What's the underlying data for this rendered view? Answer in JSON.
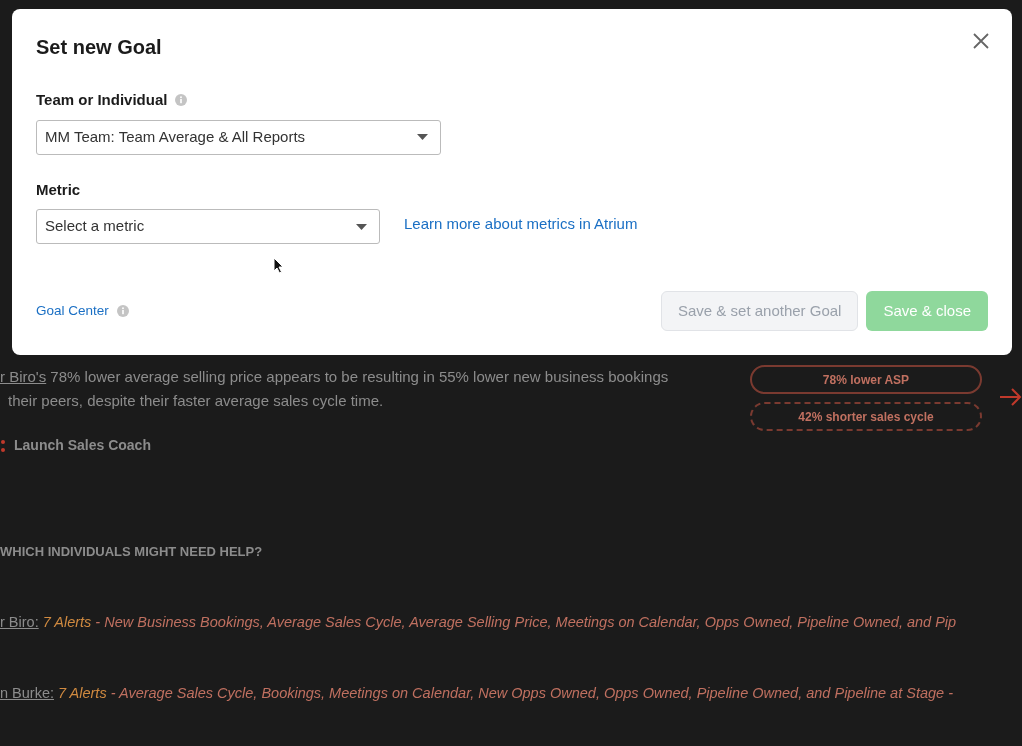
{
  "background": {
    "insight": {
      "name_link": "r Biro's",
      "line1": "78% lower average selling price appears to be resulting in 55% lower new business bookings",
      "line2": "their peers, despite their faster average sales cycle time.",
      "action": "Launch Sales Coach"
    },
    "tags": [
      {
        "label": "78% lower ASP",
        "kind": "solid"
      },
      {
        "label": "42% shorter sales cycle",
        "kind": "dashed"
      }
    ],
    "help_heading": "WHICH INDIVIDUALS MIGHT NEED HELP?",
    "alerts": [
      {
        "name": "r Biro:",
        "count": "7 Alerts",
        "detail": " - New Business Bookings, Average Sales Cycle, Average Selling Price, Meetings on Calendar, Opps Owned, Pipeline Owned, and Pip"
      },
      {
        "name": "n Burke:",
        "count": "7 Alerts",
        "detail": " - Average Sales Cycle, Bookings, Meetings on Calendar, New Opps Owned, Opps Owned, Pipeline Owned, and Pipeline at Stage -"
      }
    ]
  },
  "modal": {
    "title": "Set new Goal",
    "fields": [
      {
        "label": "Team or Individual",
        "info": true,
        "value": "MM Team: Team Average & All Reports"
      },
      {
        "label": "Metric",
        "info": false,
        "value": "Select a metric",
        "link": "Learn more about metrics in Atrium"
      }
    ],
    "footer_link": "Goal Center",
    "buttons": [
      {
        "label": "Save & set another Goal",
        "kind": "secondary",
        "disabled": true
      },
      {
        "label": "Save & close",
        "kind": "primary",
        "disabled": true
      }
    ]
  }
}
